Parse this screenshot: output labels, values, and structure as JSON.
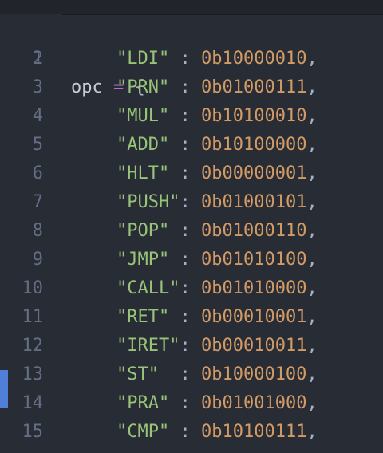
{
  "editor": {
    "first_line": {
      "number": "1",
      "var": "opc",
      "op": "=",
      "brace": "{"
    },
    "entries": [
      {
        "number": "2",
        "key": "\"LDI\"",
        "sep": " : ",
        "value": "0b10000010",
        "comma": ","
      },
      {
        "number": "3",
        "key": "\"PRN\"",
        "sep": " : ",
        "value": "0b01000111",
        "comma": ","
      },
      {
        "number": "4",
        "key": "\"MUL\"",
        "sep": " : ",
        "value": "0b10100010",
        "comma": ","
      },
      {
        "number": "5",
        "key": "\"ADD\"",
        "sep": " : ",
        "value": "0b10100000",
        "comma": ","
      },
      {
        "number": "6",
        "key": "\"HLT\"",
        "sep": " : ",
        "value": "0b00000001",
        "comma": ","
      },
      {
        "number": "7",
        "key": "\"PUSH\"",
        "sep": ": ",
        "value": "0b01000101",
        "comma": ","
      },
      {
        "number": "8",
        "key": "\"POP\"",
        "sep": " : ",
        "value": "0b01000110",
        "comma": ","
      },
      {
        "number": "9",
        "key": "\"JMP\"",
        "sep": " : ",
        "value": "0b01010100",
        "comma": ","
      },
      {
        "number": "10",
        "key": "\"CALL\"",
        "sep": ": ",
        "value": "0b01010000",
        "comma": ","
      },
      {
        "number": "11",
        "key": "\"RET\"",
        "sep": " : ",
        "value": "0b00010001",
        "comma": ","
      },
      {
        "number": "12",
        "key": "\"IRET\"",
        "sep": ": ",
        "value": "0b00010011",
        "comma": ","
      },
      {
        "number": "13",
        "key": "\"ST\"",
        "sep": "  : ",
        "value": "0b10000100",
        "comma": ","
      },
      {
        "number": "14",
        "key": "\"PRA\"",
        "sep": " : ",
        "value": "0b01001000",
        "comma": ","
      },
      {
        "number": "15",
        "key": "\"CMP\"",
        "sep": " : ",
        "value": "0b10100111",
        "comma": ","
      }
    ],
    "colors": {
      "background": "#282c34",
      "line_number": "#636d83",
      "string": "#98c379",
      "number": "#d19a66",
      "operator": "#c678dd",
      "text": "#abb2bf",
      "gutter_marker": "#4f7fd6"
    }
  }
}
